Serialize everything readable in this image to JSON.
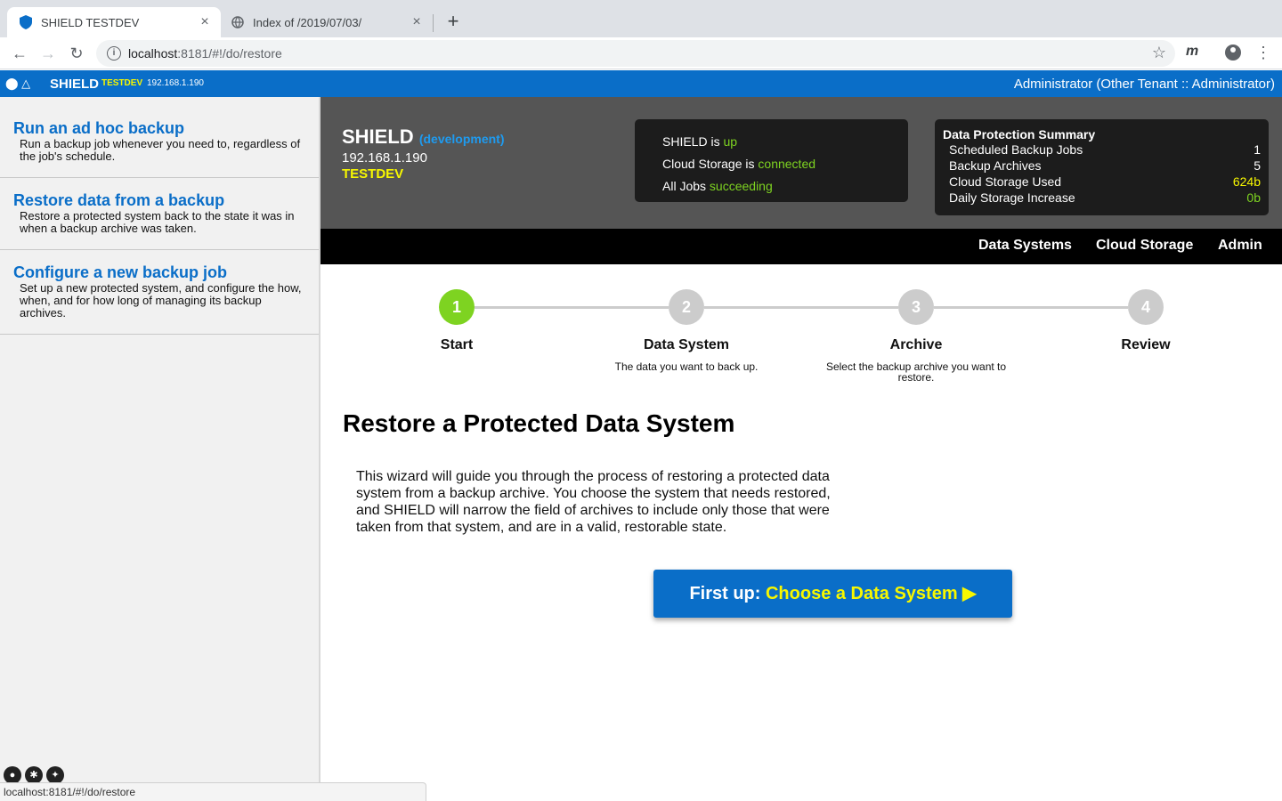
{
  "browser": {
    "tabs": [
      {
        "title": "SHIELD TESTDEV",
        "close": "×"
      },
      {
        "title": "Index of /2019/07/03/",
        "close": "×"
      }
    ],
    "new_tab": "+",
    "url_host": "localhost",
    "url_rest": ":8181/#!/do/restore",
    "extension_label": "m",
    "status_url": "localhost:8181/#!/do/restore"
  },
  "appbar": {
    "brand": "SHIELD",
    "env": "TESTDEV",
    "ip": "192.168.1.190",
    "user": "Administrator (Other Tenant :: Administrator)"
  },
  "sidebar": {
    "items": [
      {
        "title": "Run an ad hoc backup",
        "desc": "Run a backup job whenever you need to, regardless of the job's schedule."
      },
      {
        "title": "Restore data from a backup",
        "desc": "Restore a protected system back to the state it was in when a backup archive was taken."
      },
      {
        "title": "Configure a new backup job",
        "desc": "Set up a new protected system, and configure the how, when, and for how long of managing its backup archives."
      }
    ]
  },
  "dashboard": {
    "name": "SHIELD",
    "mode": "(development)",
    "ip": "192.168.1.190",
    "env": "TESTDEV",
    "status": [
      {
        "label": "SHIELD is ",
        "value": "up"
      },
      {
        "label": "Cloud Storage is ",
        "value": "connected"
      },
      {
        "label": "All Jobs ",
        "value": "succeeding"
      }
    ],
    "summary": {
      "title": "Data Protection Summary",
      "rows": [
        {
          "label": "Scheduled Backup Jobs",
          "value": "1"
        },
        {
          "label": "Backup Archives",
          "value": "5"
        },
        {
          "label": "Cloud Storage Used",
          "value": "624b"
        },
        {
          "label": "Daily Storage Increase",
          "value": "0b"
        }
      ]
    }
  },
  "nav": {
    "data_systems": "Data Systems",
    "cloud_storage": "Cloud Storage",
    "admin": "Admin"
  },
  "wizard": {
    "steps": [
      {
        "num": "1",
        "label": "Start",
        "desc": "",
        "active": true
      },
      {
        "num": "2",
        "label": "Data System",
        "desc": "The data you want to back up.",
        "active": false
      },
      {
        "num": "3",
        "label": "Archive",
        "desc": "Select the backup archive you want to restore.",
        "active": false
      },
      {
        "num": "4",
        "label": "Review",
        "desc": "",
        "active": false
      }
    ],
    "heading": "Restore a Protected Data System",
    "intro": "This wizard will guide you through the process of restoring a protected data system from a backup archive. You choose the system that needs restored, and SHIELD will narrow the field of archives to include only those that were taken from that system, and are in a valid, restorable state.",
    "cta_prefix": "First up: ",
    "cta_highlight": "Choose a Data System ▶"
  },
  "colors": {
    "brand_blue": "#0a6ec8",
    "ok_green": "#7ed321",
    "env_yellow": "#f7f700"
  }
}
